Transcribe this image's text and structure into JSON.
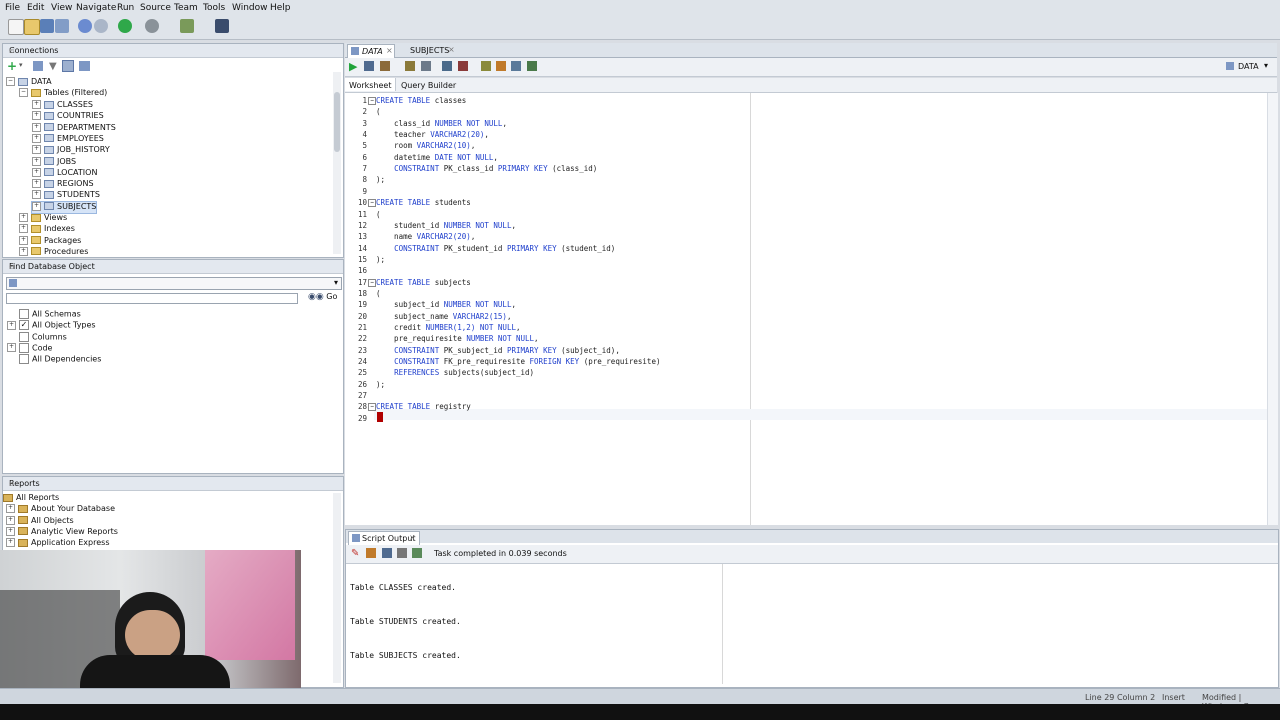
{
  "menu": [
    "File",
    "Edit",
    "View",
    "Navigate",
    "Run",
    "Source",
    "Team",
    "Tools",
    "Window",
    "Help"
  ],
  "connections": {
    "title": "Connections",
    "root": "DATA",
    "tables_folder": "Tables (Filtered)",
    "tables": [
      "CLASSES",
      "COUNTRIES",
      "DEPARTMENTS",
      "EMPLOYEES",
      "JOB_HISTORY",
      "JOBS",
      "LOCATION",
      "REGIONS",
      "STUDENTS",
      "SUBJECTS"
    ],
    "selected_table": "SUBJECTS",
    "other_folders": [
      "Views",
      "Indexes",
      "Packages",
      "Procedures"
    ]
  },
  "find_db": {
    "title": "Find Database Object",
    "go_label": "Go",
    "options": [
      {
        "label": "All Schemas",
        "checked": false
      },
      {
        "label": "All Object Types",
        "checked": true
      },
      {
        "label": "Columns",
        "checked": false
      },
      {
        "label": "Code",
        "checked": false
      },
      {
        "label": "All Dependencies",
        "checked": false
      }
    ]
  },
  "reports": {
    "title": "Reports",
    "items": [
      "All Reports",
      "About Your Database",
      "All Objects",
      "Analytic View Reports",
      "Application Express"
    ]
  },
  "editor": {
    "tabs": [
      "DATA",
      "SUBJECTS"
    ],
    "active_tab": "DATA",
    "subtabs": [
      "Worksheet",
      "Query Builder"
    ],
    "connection": "DATA",
    "lines": [
      "CREATE TABLE classes",
      "(",
      "    class_id NUMBER NOT NULL,",
      "    teacher VARCHAR2(20),",
      "    room VARCHAR2(10),",
      "    datetime DATE NOT NULL,",
      "    CONSTRAINT PK_class_id PRIMARY KEY (class_id)",
      ");",
      "",
      "CREATE TABLE students",
      "(",
      "    student_id NUMBER NOT NULL,",
      "    name VARCHAR2(20),",
      "    CONSTRAINT PK_student_id PRIMARY KEY (student_id)",
      ");",
      "",
      "CREATE TABLE subjects",
      "(",
      "    subject_id NUMBER NOT NULL,",
      "    subject_name VARCHAR2(15),",
      "    credit NUMBER(1,2) NOT NULL,",
      "    pre_requiresite NUMBER NOT NULL,",
      "    CONSTRAINT PK_subject_id PRIMARY KEY (subject_id),",
      "    CONSTRAINT FK_pre_requiresite FOREIGN KEY (pre_requiresite)",
      "    REFERENCES subjects(subject_id)",
      ");",
      "",
      "CREATE TABLE registry",
      ""
    ]
  },
  "output": {
    "tab": "Script Output",
    "status": "Task completed in 0.039 seconds",
    "lines": [
      "Table CLASSES created.",
      "Table STUDENTS created.",
      "Table SUBJECTS created."
    ]
  },
  "status": {
    "position": "Line 29 Column 2",
    "mode": "Insert",
    "extra": "Modified | Windows: C"
  },
  "colors": {
    "keyword": "#1f3fcc",
    "accent": "#2b5797",
    "cursor": "#b00000"
  }
}
